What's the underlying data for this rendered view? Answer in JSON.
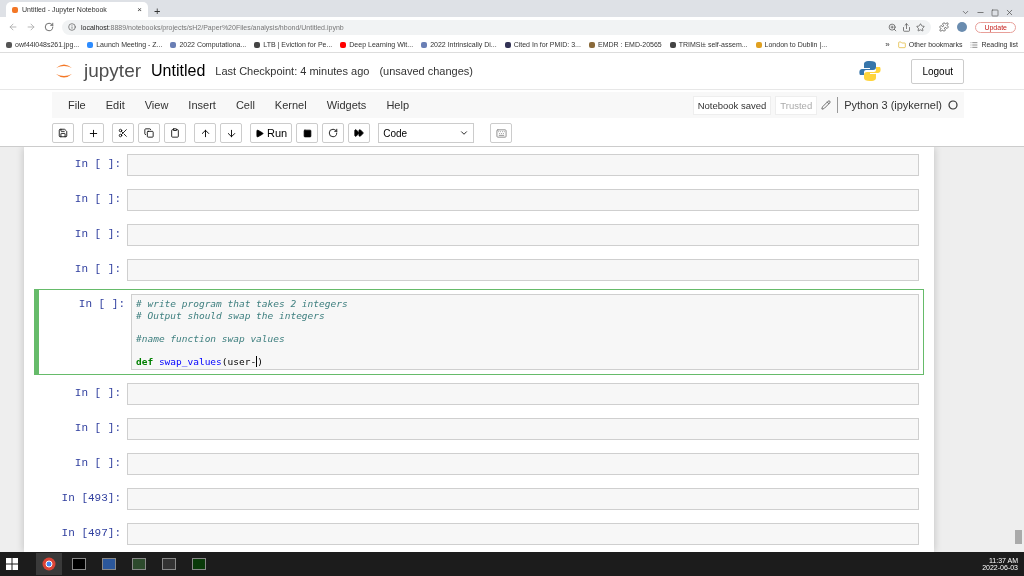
{
  "browser": {
    "tab": {
      "title": "Untitled - Jupyter Notebook",
      "close": "×"
    },
    "new_tab": "+",
    "url_host": "localhost",
    "url_rest": ":8889/notebooks/projects/sH2/Paper%20Files/analysis/hbond/Untitled.ipynb",
    "update_button": "Update",
    "bookmarks": [
      {
        "label": "owf44l048s261.jpg...",
        "color": "#555555"
      },
      {
        "label": "Launch Meeting - Z...",
        "color": "#2d8cff"
      },
      {
        "label": "2022 Computationa...",
        "color": "#6a7fb5"
      },
      {
        "label": "LTB | Eviction for Pe...",
        "color": "#444444"
      },
      {
        "label": "Deep Learning Wit...",
        "color": "#ff0000"
      },
      {
        "label": "2022 Intrinsically Di...",
        "color": "#6a7fb5"
      },
      {
        "label": "Cited In for PMID: 3...",
        "color": "#333355"
      },
      {
        "label": "EMDR : EMD-20565",
        "color": "#8a6a3a"
      },
      {
        "label": "TRIMSi± self-assem...",
        "color": "#444444"
      },
      {
        "label": "London to Dublin |...",
        "color": "#e0a020"
      }
    ],
    "more": "»",
    "other_bookmarks": "Other bookmarks",
    "reading_list": "Reading list"
  },
  "header": {
    "logo": "jupyter",
    "notebook_name": "Untitled",
    "checkpoint": "Last Checkpoint: 4 minutes ago",
    "unsaved": "(unsaved changes)",
    "logout": "Logout"
  },
  "menu": [
    "File",
    "Edit",
    "View",
    "Insert",
    "Cell",
    "Kernel",
    "Widgets",
    "Help"
  ],
  "status": {
    "saved": "Notebook saved",
    "trusted": "Trusted",
    "kernel": "Python 3 (ipykernel)"
  },
  "toolbar": {
    "run": "Run",
    "cell_type": "Code"
  },
  "cells": [
    {
      "prompt": "In [ ]:",
      "selected": false
    },
    {
      "prompt": "In [ ]:",
      "selected": false
    },
    {
      "prompt": "In [ ]:",
      "selected": false
    },
    {
      "prompt": "In [ ]:",
      "selected": false
    },
    {
      "prompt": "In [ ]:",
      "selected": true,
      "lines": [
        {
          "segments": [
            {
              "kind": "comment",
              "text": "# write program that takes 2 integers"
            }
          ]
        },
        {
          "segments": [
            {
              "kind": "comment",
              "text": "# Output should swap the integers"
            }
          ]
        },
        {
          "blank_before": true,
          "segments": [
            {
              "kind": "comment",
              "text": "#name function swap values"
            }
          ]
        },
        {
          "blank_before": true,
          "segments": [
            {
              "kind": "keyword",
              "text": "def"
            },
            {
              "kind": "defname",
              "text": " swap_values"
            },
            {
              "kind": "plain",
              "text": "(user-"
            },
            {
              "kind": "cursor",
              "text": ")"
            }
          ]
        }
      ]
    },
    {
      "prompt": "In [ ]:",
      "selected": false
    },
    {
      "prompt": "In [ ]:",
      "selected": false
    },
    {
      "prompt": "In [ ]:",
      "selected": false
    },
    {
      "prompt": "In [493]:",
      "selected": false
    },
    {
      "prompt": "In [497]:",
      "selected": false
    }
  ],
  "taskbar": {
    "time": "11:37 AM",
    "date": "2022-06-03"
  }
}
